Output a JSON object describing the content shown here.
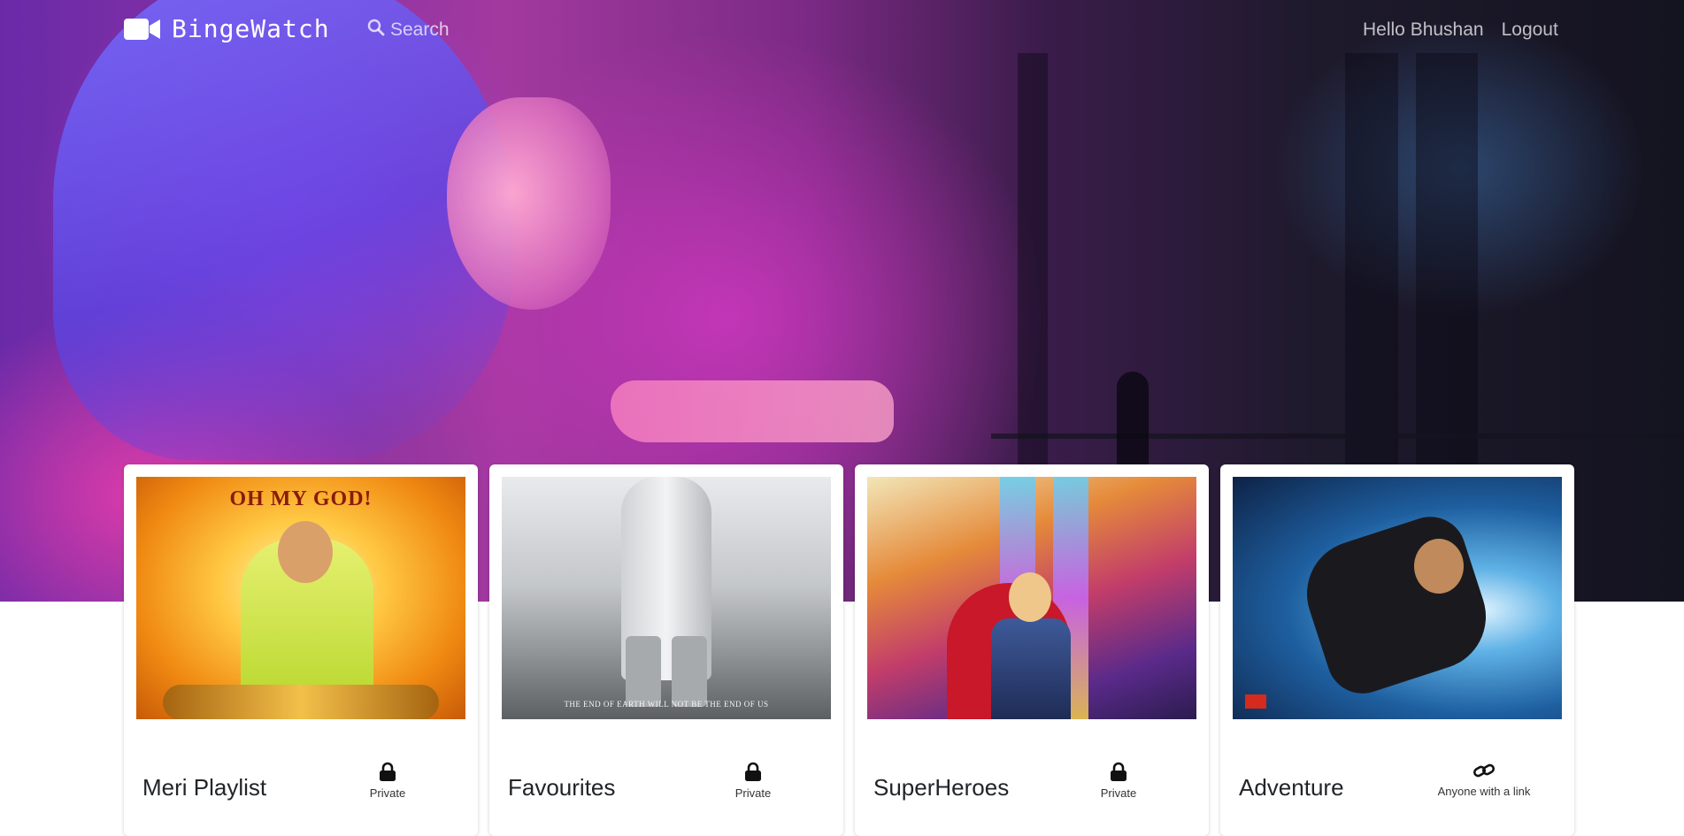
{
  "navbar": {
    "brand": "BingeWatch",
    "brand_icon": "video-camera-icon",
    "search_label": "Search",
    "search_icon": "search-icon",
    "greeting": "Hello Bhushan",
    "logout_label": "Logout"
  },
  "hero": {
    "description_icon": "hero-background-image"
  },
  "playlists": [
    {
      "title": "Meri Playlist",
      "privacy": "Private",
      "privacy_icon": "lock-icon",
      "poster_text": "OH MY GOD!"
    },
    {
      "title": "Favourites",
      "privacy": "Private",
      "privacy_icon": "lock-icon",
      "poster_text": "THE END OF EARTH WILL NOT BE THE END OF US"
    },
    {
      "title": "SuperHeroes",
      "privacy": "Private",
      "privacy_icon": "lock-icon",
      "poster_text": ""
    },
    {
      "title": "Adventure",
      "privacy": "Anyone with a link",
      "privacy_icon": "link-icon",
      "poster_text": ""
    }
  ],
  "colors": {
    "text_primary": "#212529",
    "nav_text": "#ffffffb8",
    "card_bg": "#ffffff"
  }
}
